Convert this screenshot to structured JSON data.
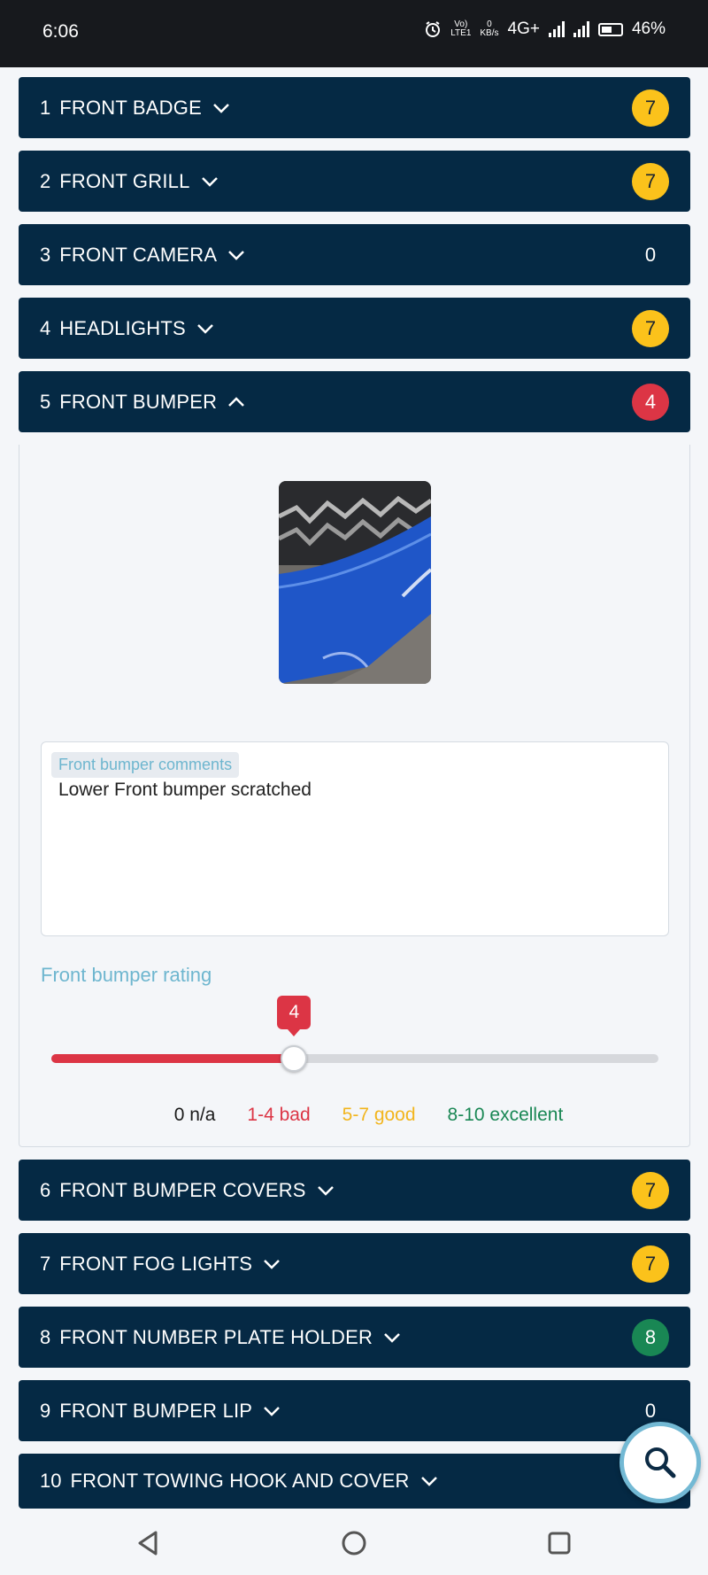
{
  "status": {
    "time": "6:06",
    "volte_top": "Vo)",
    "volte_bottom": "LTE1",
    "speed_top": "0",
    "speed_bottom": "KB/s",
    "network": "4G+",
    "battery": "46%"
  },
  "sections": [
    {
      "num": "1",
      "label": "FRONT BADGE",
      "score": "7",
      "score_color": "yellow"
    },
    {
      "num": "2",
      "label": "FRONT GRILL",
      "score": "7",
      "score_color": "yellow"
    },
    {
      "num": "3",
      "label": "FRONT CAMERA",
      "score": "0",
      "score_color": "none"
    },
    {
      "num": "4",
      "label": "HEADLIGHTS",
      "score": "7",
      "score_color": "yellow"
    },
    {
      "num": "5",
      "label": "FRONT BUMPER",
      "score": "4",
      "score_color": "red",
      "expanded": true
    },
    {
      "num": "6",
      "label": "FRONT BUMPER COVERS",
      "score": "7",
      "score_color": "yellow"
    },
    {
      "num": "7",
      "label": "FRONT FOG LIGHTS",
      "score": "7",
      "score_color": "yellow"
    },
    {
      "num": "8",
      "label": "FRONT NUMBER PLATE HOLDER",
      "score": "8",
      "score_color": "green"
    },
    {
      "num": "9",
      "label": "FRONT BUMPER LIP",
      "score": "0",
      "score_color": "none"
    },
    {
      "num": "10",
      "label": "FRONT TOWING HOOK AND COVER",
      "score": "",
      "score_color": "none"
    }
  ],
  "detail": {
    "comments_label": "Front bumper comments",
    "comments_value": "Lower Front bumper scratched",
    "rating_label": "Front bumper rating",
    "rating_value": "4",
    "rating_fraction": 0.4,
    "legend": [
      {
        "text": "0 n/a",
        "color": "#1a1a1a"
      },
      {
        "text": "1-4 bad",
        "color": "#dc3545"
      },
      {
        "text": "5-7 good",
        "color": "#f2b51d"
      },
      {
        "text": "8-10 excellent",
        "color": "#198754"
      }
    ]
  },
  "icons": {
    "fab": "search-icon",
    "nav_back": "back-triangle-icon",
    "nav_home": "home-circle-icon",
    "nav_recents": "recents-square-icon"
  }
}
